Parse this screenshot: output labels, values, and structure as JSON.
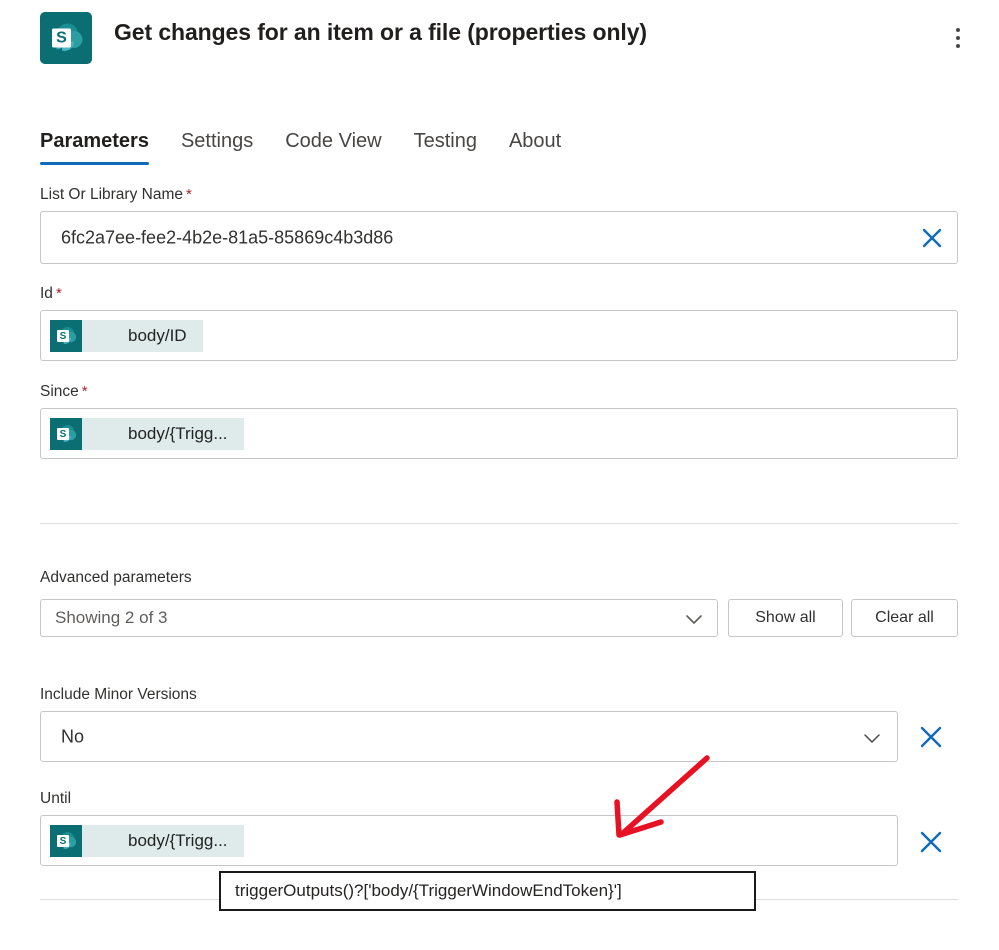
{
  "header": {
    "title": "Get changes for an item or a file (properties only)",
    "icon": "sharepoint-icon",
    "menu_icon": "more-vertical-icon"
  },
  "tabs": [
    {
      "label": "Parameters",
      "active": true
    },
    {
      "label": "Settings",
      "active": false
    },
    {
      "label": "Code View",
      "active": false
    },
    {
      "label": "Testing",
      "active": false
    },
    {
      "label": "About",
      "active": false
    }
  ],
  "parameters": {
    "list_or_library": {
      "label": "List Or Library Name",
      "required_marker": "*",
      "value": "6fc2a7ee-fee2-4b2e-81a5-85869c4b3d86",
      "clear_icon": "close-icon"
    },
    "id": {
      "label": "Id",
      "required_marker": "*",
      "token": "body/ID",
      "token_icon": "sharepoint-icon"
    },
    "since": {
      "label": "Since",
      "required_marker": "*",
      "token": "body/{Trigg...",
      "token_icon": "sharepoint-icon"
    }
  },
  "advanced": {
    "section_label": "Advanced parameters",
    "dropdown_value": "Showing 2 of 3",
    "dropdown_icon": "chevron-down-icon",
    "show_all_label": "Show all",
    "clear_all_label": "Clear all",
    "include_minor_versions": {
      "label": "Include Minor Versions",
      "value": "No",
      "dropdown_icon": "chevron-down-icon",
      "clear_icon": "close-icon"
    },
    "until": {
      "label": "Until",
      "token": "body/{Trigg...",
      "token_icon": "sharepoint-icon",
      "clear_icon": "close-icon"
    }
  },
  "tooltip": {
    "text": "triggerOutputs()?['body/{TriggerWindowEndToken}']"
  },
  "annotation": {
    "arrow_color": "#e81123",
    "name": "red-arrow-annotation"
  },
  "colors": {
    "accent_blue": "#0f6cbd",
    "clear_blue": "#0f6cbd",
    "sharepoint_teal": "#0a6e72",
    "required_red": "#a4262c",
    "token_bg": "#dfeaea"
  }
}
